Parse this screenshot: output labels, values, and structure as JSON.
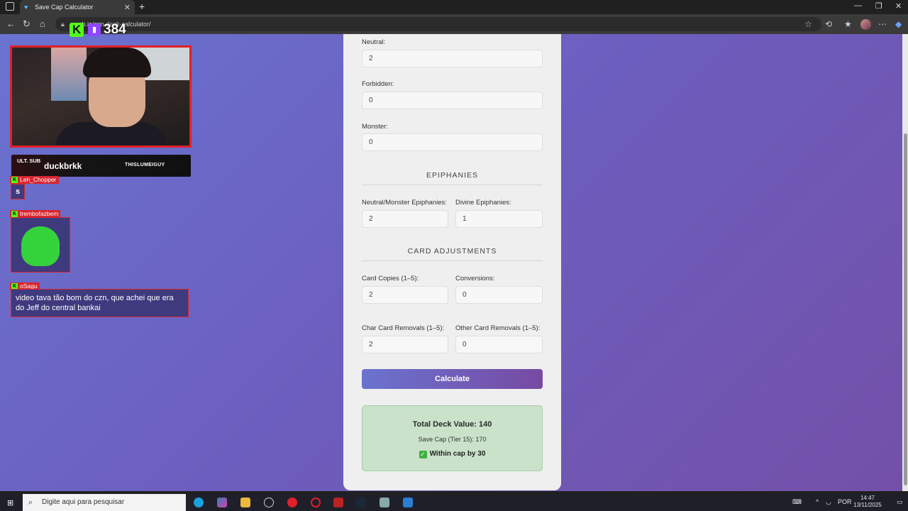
{
  "browser": {
    "tab_title": "Save Cap Calculator",
    "url": "https://...github.io/czn-deck-calculator/",
    "url_visible": "...nub.io/czn-deck-calculator/"
  },
  "stream": {
    "viewer_count": "384",
    "sub_badge": "ULT. SUB",
    "sub_user": "duckbrkk",
    "sub_brand": "THISLUMEIGUY",
    "chat": [
      {
        "user": "Leh_Chopper",
        "message": "s"
      },
      {
        "user": "trembofazbem",
        "message": ""
      },
      {
        "user": "oSagu",
        "message": "video tava tão bom do czn, que achei que era do Jeff do central bankai"
      }
    ]
  },
  "calculator": {
    "fields": {
      "neutral": {
        "label": "Neutral:",
        "value": "2"
      },
      "forbidden": {
        "label": "Forbidden:",
        "value": "0"
      },
      "monster": {
        "label": "Monster:",
        "value": "0"
      }
    },
    "epiphanies": {
      "title": "EPIPHANIES",
      "neutral_monster": {
        "label": "Neutral/Monster Epiphanies:",
        "value": "2"
      },
      "divine": {
        "label": "Divine Epiphanies:",
        "value": "1"
      }
    },
    "adjustments": {
      "title": "CARD ADJUSTMENTS",
      "copies": {
        "label": "Card Copies (1–5):",
        "value": "2"
      },
      "conversions": {
        "label": "Conversions:",
        "value": "0"
      },
      "char_removals": {
        "label": "Char Card Removals (1–5):",
        "value": "2"
      },
      "other_removals": {
        "label": "Other Card Removals (1–5):",
        "value": "0"
      }
    },
    "calculate_label": "Calculate",
    "result": {
      "total": "Total Deck Value: 140",
      "save_cap": "Save Cap (Tier 15): 170",
      "status": "Within cap by 30"
    }
  },
  "taskbar": {
    "search_placeholder": "Digite aqui para pesquisar",
    "language": "POR",
    "time": "14:47",
    "date": "13/11/2025"
  },
  "colors": {
    "accent_start": "#6a73cf",
    "accent_end": "#774aa3",
    "result_bg": "#c9e2c9",
    "kick_green": "#53fc18",
    "overlay_red": "#d8262f"
  }
}
